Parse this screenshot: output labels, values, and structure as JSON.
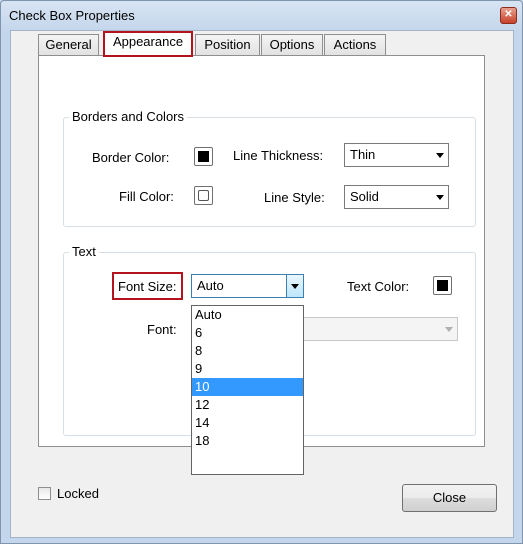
{
  "window": {
    "title": "Check Box Properties",
    "close_glyph": "✕"
  },
  "tabs": [
    {
      "label": "General",
      "active": false
    },
    {
      "label": "Appearance",
      "active": true
    },
    {
      "label": "Position",
      "active": false
    },
    {
      "label": "Options",
      "active": false
    },
    {
      "label": "Actions",
      "active": false
    }
  ],
  "borders_group": {
    "title": "Borders and Colors",
    "border_color_label": "Border Color:",
    "fill_color_label": "Fill Color:",
    "line_thickness_label": "Line Thickness:",
    "line_thickness_value": "Thin",
    "line_style_label": "Line Style:",
    "line_style_value": "Solid",
    "border_color": "#000000"
  },
  "text_group": {
    "title": "Text",
    "font_size_label": "Font Size:",
    "font_size_value": "Auto",
    "font_label": "Font:",
    "text_color_label": "Text Color:",
    "text_color": "#000000",
    "font_size_options": [
      "Auto",
      "6",
      "8",
      "9",
      "10",
      "12",
      "14",
      "18"
    ],
    "font_size_highlighted": "10"
  },
  "footer": {
    "locked_label": "Locked",
    "locked_checked": false,
    "close_label": "Close"
  },
  "colors": {
    "highlight_red": "#b2131d",
    "selection_blue": "#3399ff"
  }
}
